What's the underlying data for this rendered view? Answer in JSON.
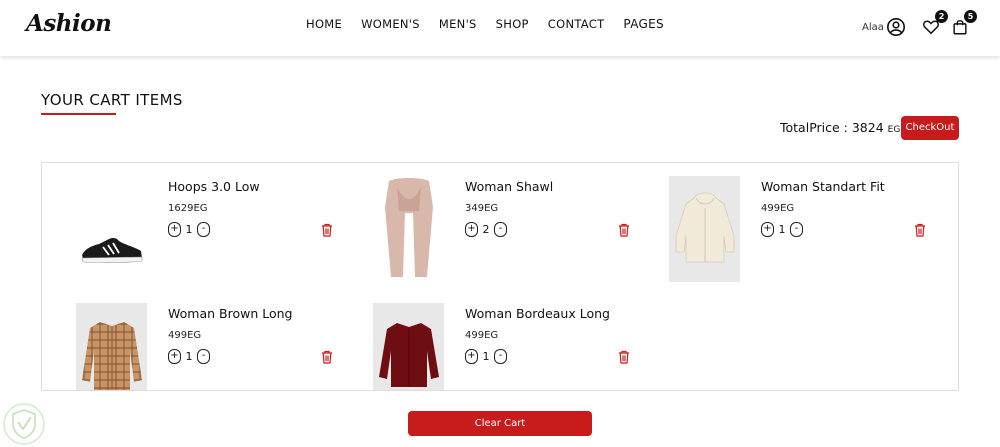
{
  "header": {
    "logo": "Ashion",
    "nav": [
      "HOME",
      "WOMEN'S",
      "MEN'S",
      "SHOP",
      "CONTACT",
      "PAGES"
    ],
    "user_name": "Alaa",
    "wishlist_count": "2",
    "cart_count": "5"
  },
  "cart": {
    "title": "YOUR CART ITEMS",
    "total_label": "TotalPrice : 3824",
    "currency": "EG",
    "checkout_label": "CheckOut",
    "clear_label": "Clear Cart",
    "items": [
      {
        "name": "Hoops 3.0 Low",
        "price": "1629EG",
        "qty": "1",
        "thumb": "sneaker-image"
      },
      {
        "name": "Woman Shawl",
        "price": "349EG",
        "qty": "2",
        "thumb": "shawl-image"
      },
      {
        "name": "Woman Standart Fit",
        "price": "499EG",
        "qty": "1",
        "thumb": "hoodie-image"
      },
      {
        "name": "Woman Brown Long",
        "price": "499EG",
        "qty": "1",
        "thumb": "plaid-shirt-image"
      },
      {
        "name": "Woman Bordeaux Long",
        "price": "499EG",
        "qty": "1",
        "thumb": "bordeaux-shirt-image"
      }
    ]
  },
  "colors": {
    "accent": "#c81b1b",
    "text": "#111111",
    "border": "#dddddd"
  }
}
